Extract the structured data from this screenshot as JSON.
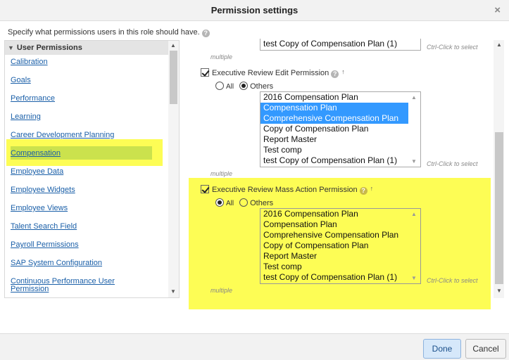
{
  "dialog": {
    "title": "Permission settings",
    "close_glyph": "×"
  },
  "intro": "Specify what permissions users in this role should have.",
  "sidebar": {
    "header": "User Permissions",
    "items": [
      "Calibration",
      "Goals",
      "Performance",
      "Learning",
      "Career Development Planning",
      "Compensation",
      "Employee Data",
      "Employee Widgets",
      "Employee Views",
      "Talent Search Field",
      "Payroll Permissions",
      "SAP System Configuration",
      "Continuous Performance User",
      "Permission"
    ],
    "selected": "Compensation"
  },
  "top_partial": {
    "option": "test Copy of Compensation Plan (1)",
    "hint": "Ctrl-Click to select",
    "multiple": "multiple"
  },
  "permissions": [
    {
      "title": "Executive Review Edit Permission",
      "checked": true,
      "radio_all": "All",
      "radio_others": "Others",
      "selected_radio": "others",
      "options": [
        "2016 Compensation Plan",
        "Compensation Plan",
        "Comprehensive Compensation Plan",
        "Copy of Compensation Plan",
        "Report Master",
        "Test comp",
        "test Copy of Compensation Plan (1)"
      ],
      "selected_options": [
        "Compensation Plan",
        "Comprehensive Compensation Plan"
      ],
      "hint": "Ctrl-Click to select",
      "multiple": "multiple"
    },
    {
      "title": "Executive Review Mass Action Permission",
      "checked": true,
      "radio_all": "All",
      "radio_others": "Others",
      "selected_radio": "all",
      "options": [
        "2016 Compensation Plan",
        "Compensation Plan",
        "Comprehensive Compensation Plan",
        "Copy of Compensation Plan",
        "Report Master",
        "Test comp",
        "test Copy of Compensation Plan (1)"
      ],
      "selected_options": [],
      "hint": "Ctrl-Click to select",
      "multiple": "multiple",
      "highlighted": true
    }
  ],
  "footer": {
    "done_label": "Done",
    "cancel_label": "Cancel"
  },
  "colors": {
    "highlight": "#fdfd55",
    "selection": "#3399ff",
    "link": "#1a5fa8"
  },
  "icons": [
    "close-icon",
    "help-icon",
    "arrow-up-icon",
    "collapse-triangle-icon",
    "checkbox-checked-icon",
    "radio-icon",
    "scroll-up-icon",
    "scroll-down-icon"
  ]
}
